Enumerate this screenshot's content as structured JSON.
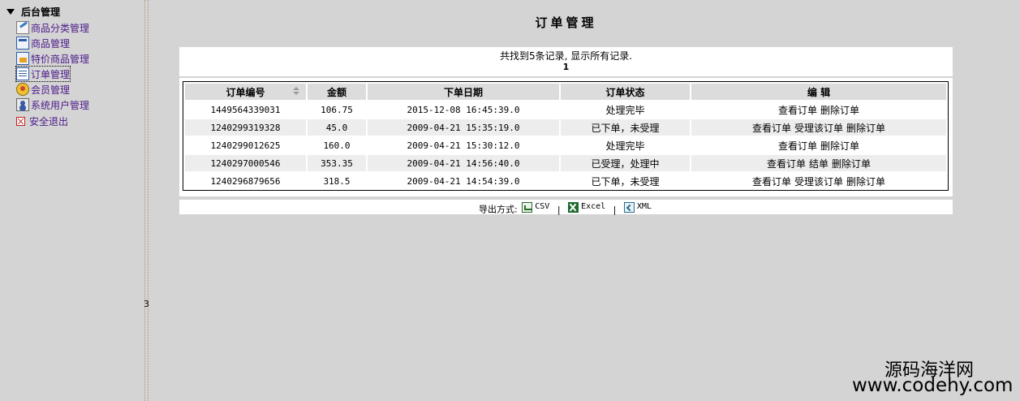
{
  "sidebar": {
    "root_label": "后台管理",
    "items": [
      {
        "label": "商品分类管理",
        "icon": "edit-category-icon"
      },
      {
        "label": "商品管理",
        "icon": "goods-window-icon"
      },
      {
        "label": "特价商品管理",
        "icon": "special-goods-icon"
      },
      {
        "label": "订单管理",
        "icon": "order-list-icon",
        "active": true
      },
      {
        "label": "会员管理",
        "icon": "member-icon"
      },
      {
        "label": "系统用户管理",
        "icon": "system-user-icon"
      },
      {
        "label": "安全退出",
        "icon": "exit-icon"
      }
    ]
  },
  "splitter_label": "3",
  "main": {
    "title": "订单管理",
    "summary": "共找到5条记录, 显示所有记录.",
    "page_number": "1",
    "columns": [
      "订单编号",
      "金额",
      "下单日期",
      "订单状态",
      "编 辑"
    ],
    "rows": [
      {
        "id": "1449564339031",
        "amount": "106.75",
        "date": "2015-12-08 16:45:39.0",
        "status": "处理完毕",
        "actions": [
          "查看订单",
          "删除订单"
        ]
      },
      {
        "id": "1240299319328",
        "amount": "45.0",
        "date": "2009-04-21 15:35:19.0",
        "status": "已下单，未受理",
        "actions": [
          "查看订单",
          "受理该订单",
          "删除订单"
        ]
      },
      {
        "id": "1240299012625",
        "amount": "160.0",
        "date": "2009-04-21 15:30:12.0",
        "status": "处理完毕",
        "actions": [
          "查看订单",
          "删除订单"
        ]
      },
      {
        "id": "1240297000546",
        "amount": "353.35",
        "date": "2009-04-21 14:56:40.0",
        "status": "已受理，处理中",
        "actions": [
          "查看订单",
          "结单",
          "删除订单"
        ]
      },
      {
        "id": "1240296879656",
        "amount": "318.5",
        "date": "2009-04-21 14:54:39.0",
        "status": "已下单，未受理",
        "actions": [
          "查看订单",
          "受理该订单",
          "删除订单"
        ]
      }
    ],
    "export": {
      "label": "导出方式:",
      "csv": "CSV",
      "excel": "Excel",
      "xml": "XML",
      "separator": "|"
    }
  },
  "watermark": {
    "title": "源码海洋网",
    "url": "www.codehy.com"
  }
}
